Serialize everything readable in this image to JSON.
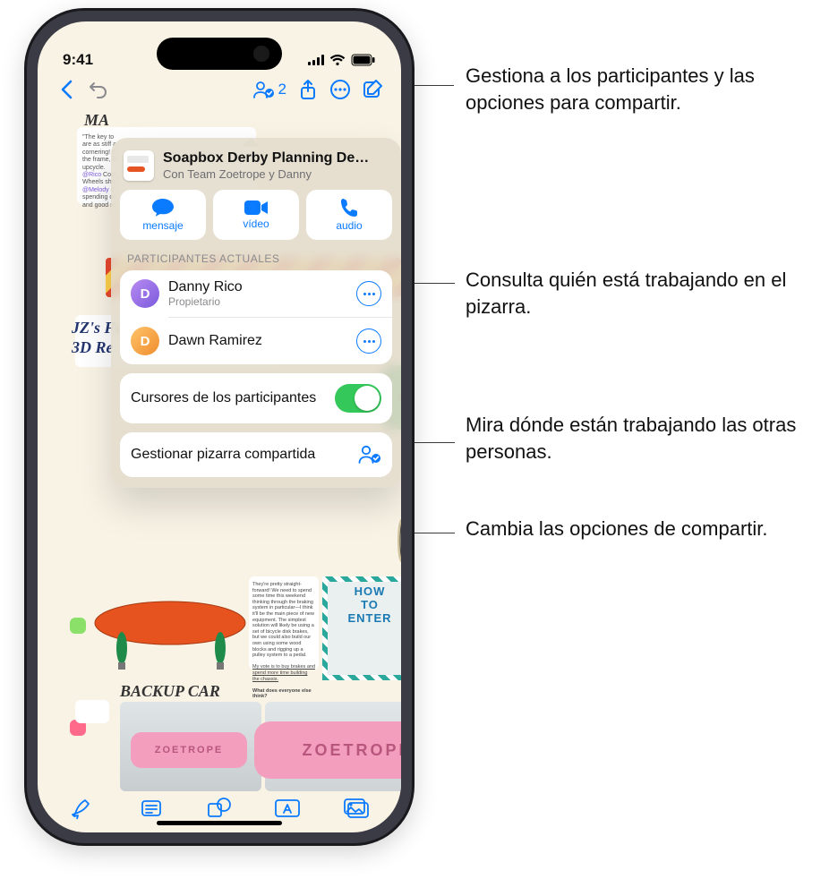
{
  "status": {
    "time": "9:41"
  },
  "toolbar": {
    "collab_count": "2"
  },
  "popover": {
    "title": "Soapbox Derby Planning De…",
    "subtitle": "Con Team Zoetrope y Danny",
    "actions": {
      "message": "mensaje",
      "video": "vídeo",
      "audio": "audio"
    },
    "participants_header": "PARTICIPANTES ACTUALES",
    "participants": [
      {
        "name": "Danny Rico",
        "role": "Propietario",
        "initial": "D"
      },
      {
        "name": "Dawn Ramirez",
        "role": "",
        "initial": "D"
      }
    ],
    "cursors_label": "Cursores de los participantes",
    "cursors_on": true,
    "manage_label": "Gestionar pizarra compartida"
  },
  "callouts": {
    "collab": "Gestiona a los participantes y las opciones para compartir.",
    "participants": "Consulta quién está trabajando en el pizarra.",
    "cursors": "Mira dónde están trabajando las otras personas.",
    "manage": "Cambia las opciones de compartir."
  },
  "canvas": {
    "heading_backup": "BACKUP CAR",
    "brand": "ZOETROPE",
    "enter_title": "HOW TO ENTER"
  }
}
